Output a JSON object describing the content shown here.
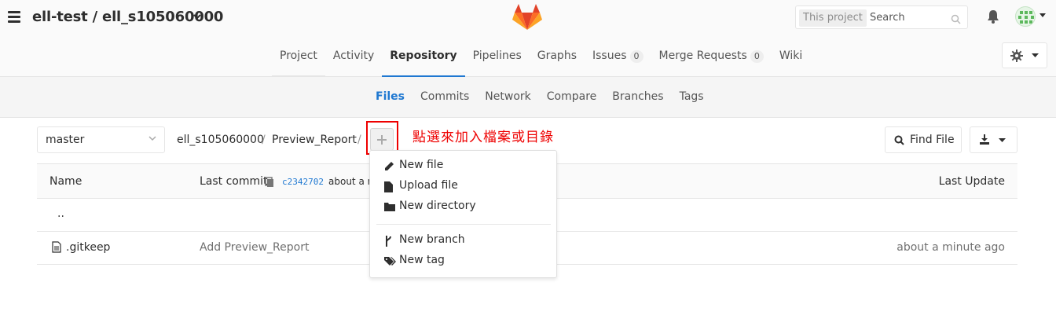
{
  "header": {
    "project_title": "ell-test / ell_s105060000",
    "search_scope": "This project",
    "search_placeholder": "Search"
  },
  "nav": {
    "items": [
      {
        "label": "Project"
      },
      {
        "label": "Activity"
      },
      {
        "label": "Repository"
      },
      {
        "label": "Pipelines"
      },
      {
        "label": "Graphs"
      },
      {
        "label": "Issues",
        "badge": "0"
      },
      {
        "label": "Merge Requests",
        "badge": "0"
      },
      {
        "label": "Wiki"
      }
    ]
  },
  "subnav": {
    "items": [
      "Files",
      "Commits",
      "Network",
      "Compare",
      "Branches",
      "Tags"
    ]
  },
  "repo": {
    "branch": "master",
    "breadcrumb": [
      "ell_s105060000",
      "Preview_Report"
    ],
    "breadcrumb_separator": "/",
    "annotation": "點選來加入檔案或目錄",
    "find_file": "Find File"
  },
  "table": {
    "headers": {
      "name": "Name",
      "last_commit": "Last commit",
      "last_update": "Last Update"
    },
    "last_commit_sha": "c2342702",
    "last_commit_time": "about a m",
    "rows": [
      {
        "name": "..",
        "message": "",
        "updated": ""
      },
      {
        "name": ".gitkeep",
        "message": "Add Preview_Report",
        "updated": "about a minute ago"
      }
    ]
  },
  "dropdown": {
    "items": [
      {
        "label": "New file",
        "icon": "pencil-icon"
      },
      {
        "label": "Upload file",
        "icon": "file-icon"
      },
      {
        "label": "New directory",
        "icon": "folder-icon"
      },
      {
        "label": "New branch",
        "icon": "branch-icon"
      },
      {
        "label": "New tag",
        "icon": "tags-icon"
      }
    ]
  },
  "colors": {
    "accent": "#1f78d1",
    "annotation": "#ee0000"
  }
}
